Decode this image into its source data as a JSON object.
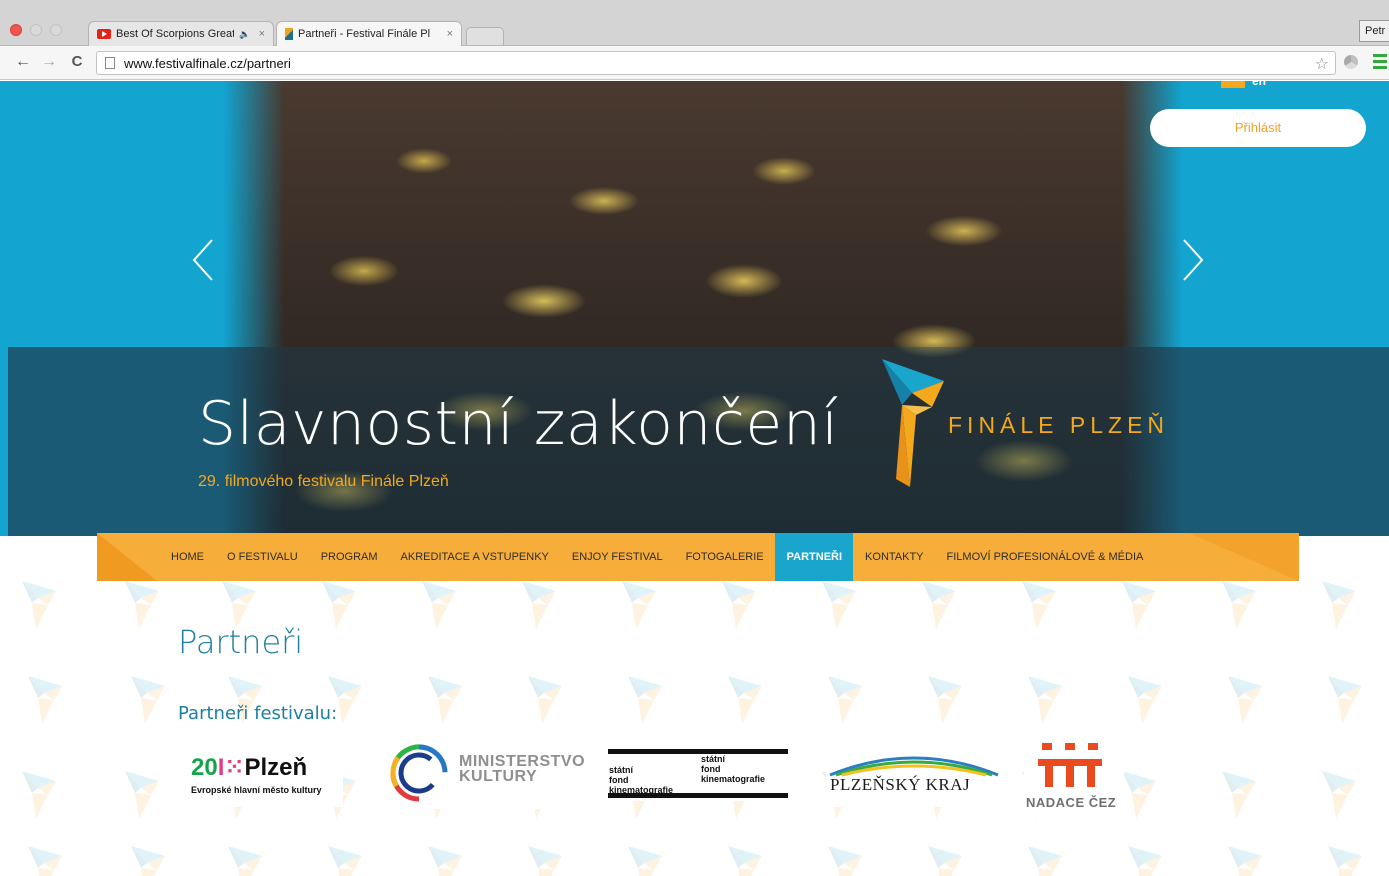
{
  "browser": {
    "tabs": [
      {
        "title": "Best Of Scorpions Great",
        "icon": "youtube-icon",
        "audio": "🔈"
      },
      {
        "title": "Partneři - Festival Finále Pl",
        "icon": "festival-favicon"
      }
    ],
    "close_glyph": "×",
    "profile_label": "Petr",
    "url": "www.festivalfinale.cz/partneri"
  },
  "header": {
    "lang_label": "en",
    "login_label": "Přihlásit"
  },
  "hero": {
    "title": "Slavnostní zakončení",
    "subtitle": "29. filmového festivalu Finále Plzeň",
    "logo_text": "FINÁLE PLZEŇ"
  },
  "nav": {
    "items": [
      {
        "label": "HOME"
      },
      {
        "label": "O FESTIVALU"
      },
      {
        "label": "PROGRAM"
      },
      {
        "label": "AKREDITACE A VSTUPENKY"
      },
      {
        "label": "ENJOY FESTIVAL"
      },
      {
        "label": "FOTOGALERIE"
      },
      {
        "label": "PARTNEŘI"
      },
      {
        "label": "KONTAKTY"
      },
      {
        "label": "FILMOVÍ PROFESIONÁLOVÉ & MÉDIA"
      }
    ],
    "active_index": 6
  },
  "content": {
    "title": "Partneři",
    "subtitle": "Partneři festivalu:"
  },
  "partners": {
    "plzen2015": {
      "main_a": "20",
      "main_b": "I",
      "main_c": "⁙",
      "main_d": "Plzeň",
      "sub": "Evropské hlavní město kultury"
    },
    "ministerstvo": {
      "text": "MINISTERSTVO\nKULTURY"
    },
    "fond": {
      "left": "státní\nfond\nkinematografie",
      "right": "státní\nfond\nkinematografie"
    },
    "kraj": {
      "text": "PLZEŇSKÝ KRAJ"
    },
    "nadace": {
      "text": "NADACE ČEZ"
    }
  },
  "colors": {
    "hero_blue": "#13a4cf",
    "accent_orange": "#f7ad39",
    "nav_active": "#1aa6cc",
    "title_blue": "#1e7fa0"
  }
}
